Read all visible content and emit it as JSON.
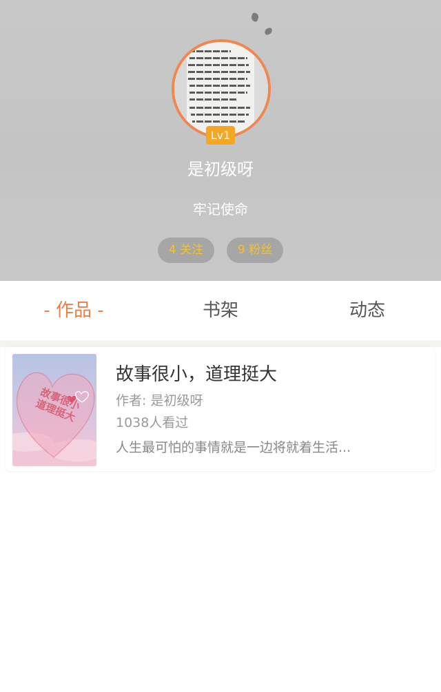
{
  "colors": {
    "accent": "#ee7d46",
    "avatar_border": "#f0874e",
    "level_badge": "#f5a723",
    "stat_text": "#f2c233",
    "header_bg": "#c6c6c6",
    "divider_bg": "#f4f3ef"
  },
  "profile": {
    "avatar_icon": "user-avatar-photo",
    "level": "Lv1",
    "username": "是初级呀",
    "signature": "牢记使命",
    "following_count": "4",
    "following_label": "关注",
    "followers_count": "9",
    "followers_label": "粉丝"
  },
  "tabs": [
    {
      "label": "- 作品 -",
      "active": true
    },
    {
      "label": "书架",
      "active": false
    },
    {
      "label": "动态",
      "active": false
    }
  ],
  "works": [
    {
      "cover_icon": "heart-cover-image",
      "cover_text_line1": "故事很小",
      "cover_text_line2": "道理挺大",
      "title": "故事很小，道理挺大",
      "author": "作者: 是初级呀",
      "views": "1038人看过",
      "summary": "人生最可怕的事情就是一边将就着生活..."
    }
  ]
}
